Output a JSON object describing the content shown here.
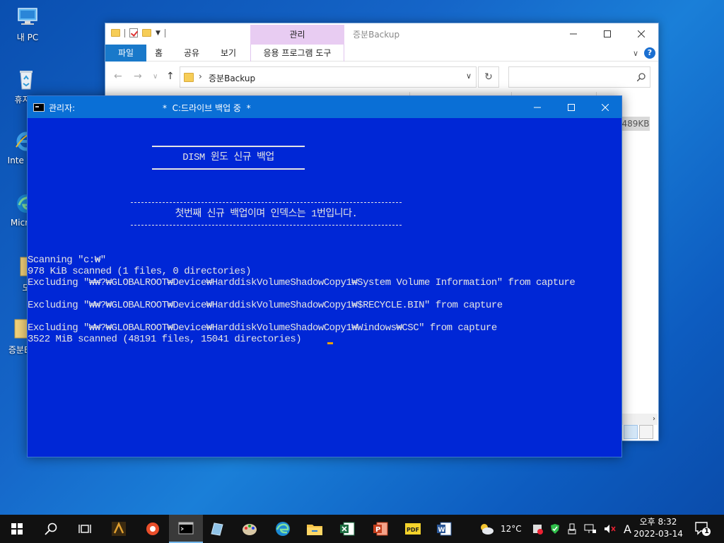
{
  "desktop": {
    "icons": [
      {
        "label": "내 PC"
      },
      {
        "label": "휴지통"
      },
      {
        "label": "Inte Expl"
      },
      {
        "label": "Micr Ed"
      },
      {
        "label": "도"
      },
      {
        "label": "증분B"
      }
    ]
  },
  "explorer": {
    "tab_manage": "관리",
    "title": "증분Backup",
    "ribbon_tabs": [
      "파일",
      "홈",
      "공유",
      "보기",
      "응용 프로그램 도구"
    ],
    "address_path": "증분Backup",
    "size_cell": "489KB",
    "help": "?"
  },
  "cmd": {
    "title_left": "관리자:",
    "title_center": "*  C:드라이브 백업 중  *",
    "banner": "DISM 윈도 신규 백업",
    "notice": "첫번째 신규 백업이며 인덱스는 1번입니다.",
    "lines": [
      "Scanning \"c:₩\"",
      "978 KiB scanned (1 files, 0 directories)",
      "Excluding \"₩₩?₩GLOBALROOT₩Device₩HarddiskVolumeShadowCopy1₩System Volume Information\" from capture",
      "",
      "Excluding \"₩₩?₩GLOBALROOT₩Device₩HarddiskVolumeShadowCopy1₩$RECYCLE.BIN\" from capture",
      "",
      "Excluding \"₩₩?₩GLOBALROOT₩Device₩HarddiskVolumeShadowCopy1₩Windows₩CSC\" from capture",
      "3522 MiB scanned (48191 files, 15041 directories)"
    ]
  },
  "taskbar": {
    "weather_temp": "12°C",
    "ime": "A",
    "time": "오후 8:32",
    "date": "2022-03-14",
    "notif_count": "1"
  },
  "colors": {
    "console_bg": "#0027d6",
    "cmd_titlebar": "#0a6fd6",
    "file_tab": "#1979ca",
    "manage_tab": "#e8ccf2",
    "cursor": "#e8a100"
  }
}
